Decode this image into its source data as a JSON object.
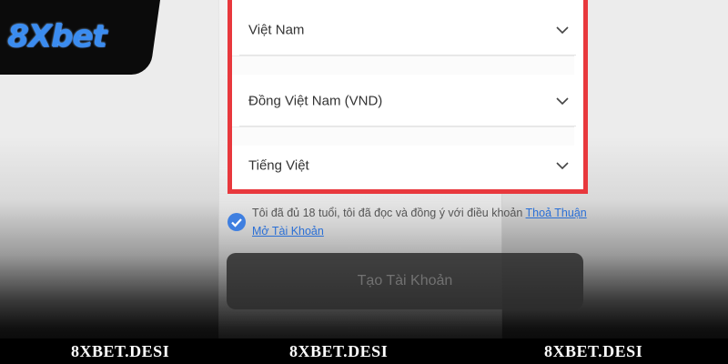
{
  "logo": {
    "text": "8Xbet"
  },
  "form": {
    "selects": [
      {
        "value": "Việt Nam"
      },
      {
        "value": "Đồng Việt Nam (VND)"
      },
      {
        "value": "Tiếng Việt"
      }
    ],
    "consent": {
      "checked": true,
      "text": "Tôi đã đủ 18 tuổi, tôi đã đọc và đồng ý với điều khoản",
      "link": "Thoả Thuận Mở Tài Khoản"
    },
    "create_button": "Tạo Tài Khoản"
  },
  "footer": {
    "brands": [
      "8XBET.DESI",
      "8XBET.DESI",
      "8XBET.DESI"
    ]
  },
  "colors": {
    "highlight_border": "#e8383d",
    "checkbox": "#3f7fe0",
    "logo_blue": "#3a8cf0"
  }
}
